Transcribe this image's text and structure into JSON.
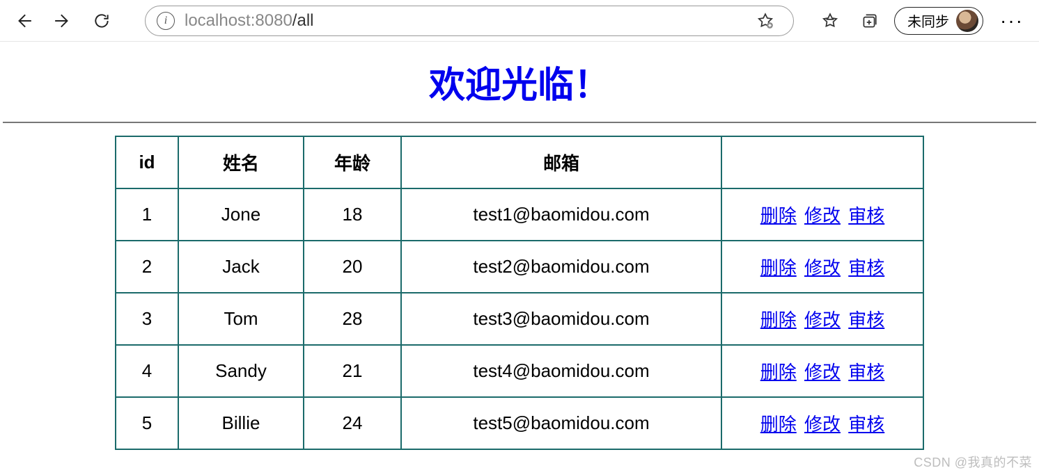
{
  "browser": {
    "url_host": "localhost",
    "url_port": ":8080",
    "url_path": "/all",
    "sync_label": "未同步"
  },
  "page": {
    "title": "欢迎光临！",
    "table": {
      "headers": {
        "id": "id",
        "name": "姓名",
        "age": "年龄",
        "email": "邮箱",
        "actions": ""
      },
      "action_labels": {
        "delete": "删除",
        "edit": "修改",
        "review": "审核"
      },
      "rows": [
        {
          "id": "1",
          "name": "Jone",
          "age": "18",
          "email": "test1@baomidou.com"
        },
        {
          "id": "2",
          "name": "Jack",
          "age": "20",
          "email": "test2@baomidou.com"
        },
        {
          "id": "3",
          "name": "Tom",
          "age": "28",
          "email": "test3@baomidou.com"
        },
        {
          "id": "4",
          "name": "Sandy",
          "age": "21",
          "email": "test4@baomidou.com"
        },
        {
          "id": "5",
          "name": "Billie",
          "age": "24",
          "email": "test5@baomidou.com"
        }
      ]
    }
  },
  "watermark": "CSDN @我真的不菜"
}
